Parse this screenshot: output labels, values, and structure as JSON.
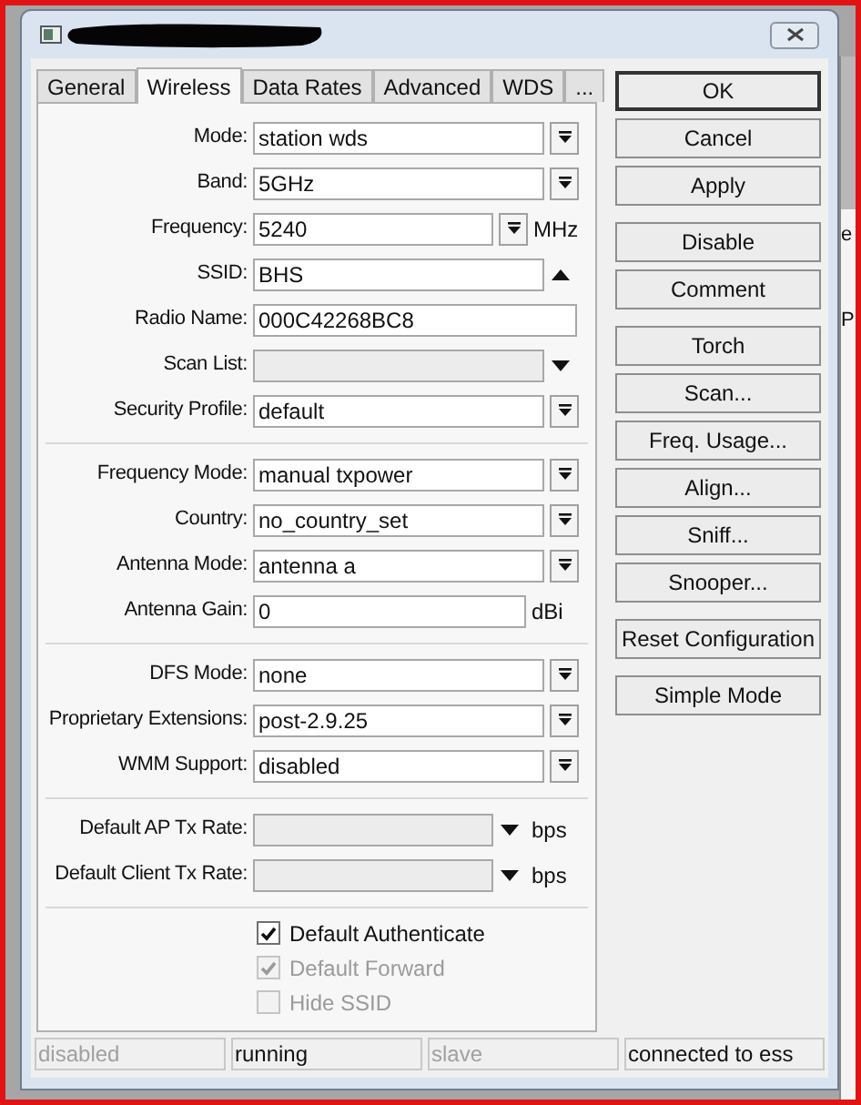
{
  "tabs": [
    {
      "label": "General",
      "selected": false
    },
    {
      "label": "Wireless",
      "selected": true
    },
    {
      "label": "Data Rates",
      "selected": false
    },
    {
      "label": "Advanced",
      "selected": false
    },
    {
      "label": "WDS",
      "selected": false
    },
    {
      "label": "...",
      "selected": false
    }
  ],
  "sections": [
    [
      {
        "label": "Mode:",
        "kind": "select",
        "value": "station wds",
        "disabled": false
      },
      {
        "label": "Band:",
        "kind": "select",
        "value": "5GHz",
        "disabled": false
      },
      {
        "label": "Frequency:",
        "kind": "select_unit",
        "value": "5240",
        "unit": "MHz",
        "disabled": false
      },
      {
        "label": "SSID:",
        "kind": "combo_up",
        "value": "BHS",
        "disabled": false
      },
      {
        "label": "Radio Name:",
        "kind": "text",
        "value": "000C42268BC8",
        "disabled": false
      },
      {
        "label": "Scan List:",
        "kind": "combo",
        "disabled": true
      },
      {
        "label": "Security Profile:",
        "kind": "select",
        "value": "default",
        "disabled": false
      }
    ],
    [
      {
        "label": "Frequency Mode:",
        "kind": "select",
        "value": "manual txpower",
        "disabled": false
      },
      {
        "label": "Country:",
        "kind": "select",
        "value": "no_country_set",
        "disabled": false
      },
      {
        "label": "Antenna Mode:",
        "kind": "select",
        "value": "antenna a",
        "disabled": false
      },
      {
        "label": "Antenna Gain:",
        "kind": "text_unit",
        "value": "0",
        "unit": "dBi",
        "disabled": false
      }
    ],
    [
      {
        "label": "DFS Mode:",
        "kind": "select",
        "value": "none",
        "disabled": false
      },
      {
        "label": "Proprietary Extensions:",
        "kind": "select",
        "value": "post-2.9.25",
        "disabled": false
      },
      {
        "label": "WMM Support:",
        "kind": "select",
        "value": "disabled",
        "disabled": false
      }
    ],
    [
      {
        "label": "Default AP Tx Rate:",
        "kind": "combo_unit",
        "unit": "bps",
        "disabled": true
      },
      {
        "label": "Default Client Tx Rate:",
        "kind": "combo_unit",
        "unit": "bps",
        "disabled": true
      }
    ]
  ],
  "checkboxes": [
    {
      "label": "Default Authenticate",
      "checked": true,
      "disabled": false
    },
    {
      "label": "Default Forward",
      "checked": true,
      "disabled": true
    },
    {
      "label": "Hide SSID",
      "checked": false,
      "disabled": true
    }
  ],
  "button_groups": [
    [
      {
        "label": "OK",
        "default": true
      },
      {
        "label": "Cancel",
        "default": false
      },
      {
        "label": "Apply",
        "default": false
      }
    ],
    [
      {
        "label": "Disable",
        "default": false
      },
      {
        "label": "Comment",
        "default": false
      }
    ],
    [
      {
        "label": "Torch",
        "default": false
      },
      {
        "label": "Scan...",
        "default": false
      },
      {
        "label": "Freq. Usage...",
        "default": false
      },
      {
        "label": "Align...",
        "default": false
      },
      {
        "label": "Sniff...",
        "default": false
      },
      {
        "label": "Snooper...",
        "default": false
      }
    ],
    [
      {
        "label": "Reset Configuration",
        "default": false
      }
    ],
    [
      {
        "label": "Simple Mode",
        "default": false
      }
    ]
  ],
  "status_bar": [
    {
      "text": "disabled",
      "active": false
    },
    {
      "text": "running",
      "active": true
    },
    {
      "text": "slave",
      "active": false
    },
    {
      "text": "connected to ess",
      "active": true
    }
  ],
  "background_window": {
    "texts": [
      "e",
      "P"
    ]
  }
}
